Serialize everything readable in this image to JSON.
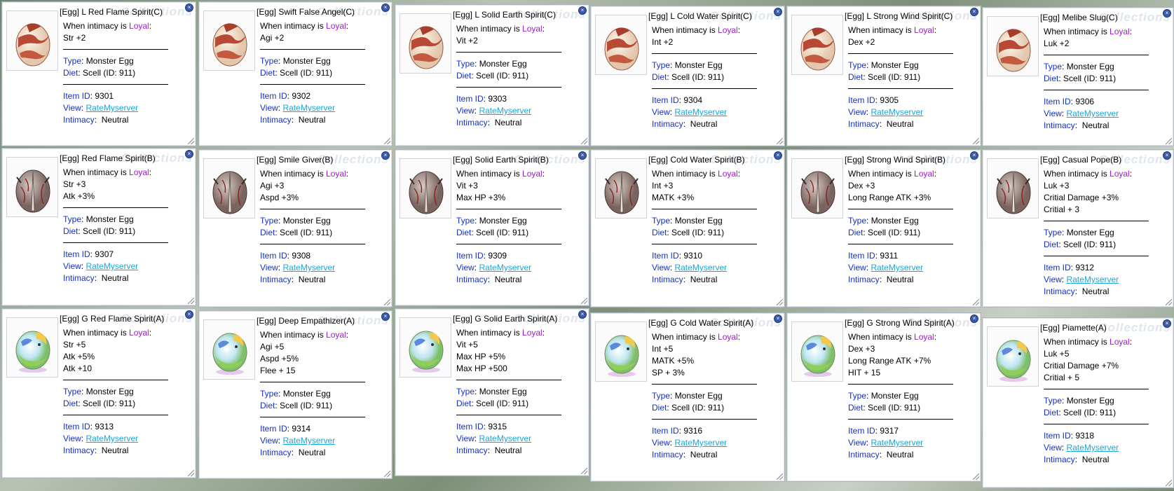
{
  "labels": {
    "when_prefix": "When intimacy is ",
    "loyal": "Loyal",
    "type_label": "Type",
    "type_value": "Monster Egg",
    "diet_label": "Diet",
    "diet_value": "Scell (ID: 911)",
    "item_id_label": "Item ID",
    "view_label": "View",
    "view_link": "RateMyserver",
    "intimacy_label": "Intimacy",
    "intimacy_value": "Neutral",
    "watermark": "Collections"
  },
  "colors": {
    "label_blue": "#1530c8",
    "loyal_purple": "#a11bd3",
    "link_cyan": "#1aa6d8"
  },
  "cards": [
    {
      "title": "[Egg] L Red Flame Spirit(C)",
      "egg": "red",
      "bonuses": [
        "Str +2"
      ],
      "item_id": "9301"
    },
    {
      "title": "[Egg] Swift False Angel(C)",
      "egg": "red",
      "bonuses": [
        "Agi +2"
      ],
      "item_id": "9302"
    },
    {
      "title": "[Egg] L Solid Earth Spirit(C)",
      "egg": "red",
      "bonuses": [
        "Vit +2"
      ],
      "item_id": "9303"
    },
    {
      "title": "[Egg] L Cold Water Spirit(C)",
      "egg": "red",
      "bonuses": [
        "Int +2"
      ],
      "item_id": "9304"
    },
    {
      "title": "[Egg] L Strong Wind Spirit(C)",
      "egg": "red",
      "bonuses": [
        "Dex +2"
      ],
      "item_id": "9305"
    },
    {
      "title": "[Egg] Melibe Slug(C)",
      "egg": "red",
      "bonuses": [
        "Luk +2"
      ],
      "item_id": "9306"
    },
    {
      "title": "[Egg] Red Flame Spirit(B)",
      "egg": "grey",
      "bonuses": [
        "Str +3",
        "Atk +3%"
      ],
      "item_id": "9307"
    },
    {
      "title": "[Egg] Smile Giver(B)",
      "egg": "grey",
      "bonuses": [
        "Agi +3",
        "Aspd +3%"
      ],
      "item_id": "9308"
    },
    {
      "title": "[Egg] Solid Earth Spirit(B)",
      "egg": "grey",
      "bonuses": [
        "Vit +3",
        "Max HP +3%"
      ],
      "item_id": "9309"
    },
    {
      "title": "[Egg] Cold Water Spirit(B)",
      "egg": "grey",
      "bonuses": [
        "Int +3",
        "MATK +3%"
      ],
      "item_id": "9310"
    },
    {
      "title": "[Egg] Strong Wind Spirit(B)",
      "egg": "grey",
      "bonuses": [
        "Dex +3",
        "Long Range ATK +3%"
      ],
      "item_id": "9311"
    },
    {
      "title": "[Egg] Casual Pope(B)",
      "egg": "grey",
      "bonuses": [
        "Luk +3",
        "Critial Damage +3%",
        "Critial + 3"
      ],
      "item_id": "9312"
    },
    {
      "title": "[Egg] G Red Flame Spirit(A)",
      "egg": "dragon",
      "bonuses": [
        "Str +5",
        "Atk +5%",
        "Atk +10"
      ],
      "item_id": "9313"
    },
    {
      "title": "[Egg] Deep Empathizer(A)",
      "egg": "dragon",
      "bonuses": [
        "Agi +5",
        "Aspd +5%",
        "Flee + 15"
      ],
      "item_id": "9314"
    },
    {
      "title": "[Egg] G Solid Earth Spirit(A)",
      "egg": "dragon",
      "bonuses": [
        "Vit +5",
        "Max HP +5%",
        "Max HP +500"
      ],
      "item_id": "9315"
    },
    {
      "title": "[Egg] G Cold Water Spirit(A)",
      "egg": "dragon",
      "bonuses": [
        "Int +5",
        "MATK +5%",
        "SP + 3%"
      ],
      "item_id": "9316"
    },
    {
      "title": "[Egg] G Strong Wind Spirit(A)",
      "egg": "dragon",
      "bonuses": [
        "Dex +3",
        "Long Range ATK +7%",
        "HIT + 15"
      ],
      "item_id": "9317"
    },
    {
      "title": "[Egg] Piamette(A)",
      "egg": "dragon",
      "bonuses": [
        "Luk +5",
        "Critial Damage +7%",
        "Critial + 5"
      ],
      "item_id": "9318"
    }
  ]
}
